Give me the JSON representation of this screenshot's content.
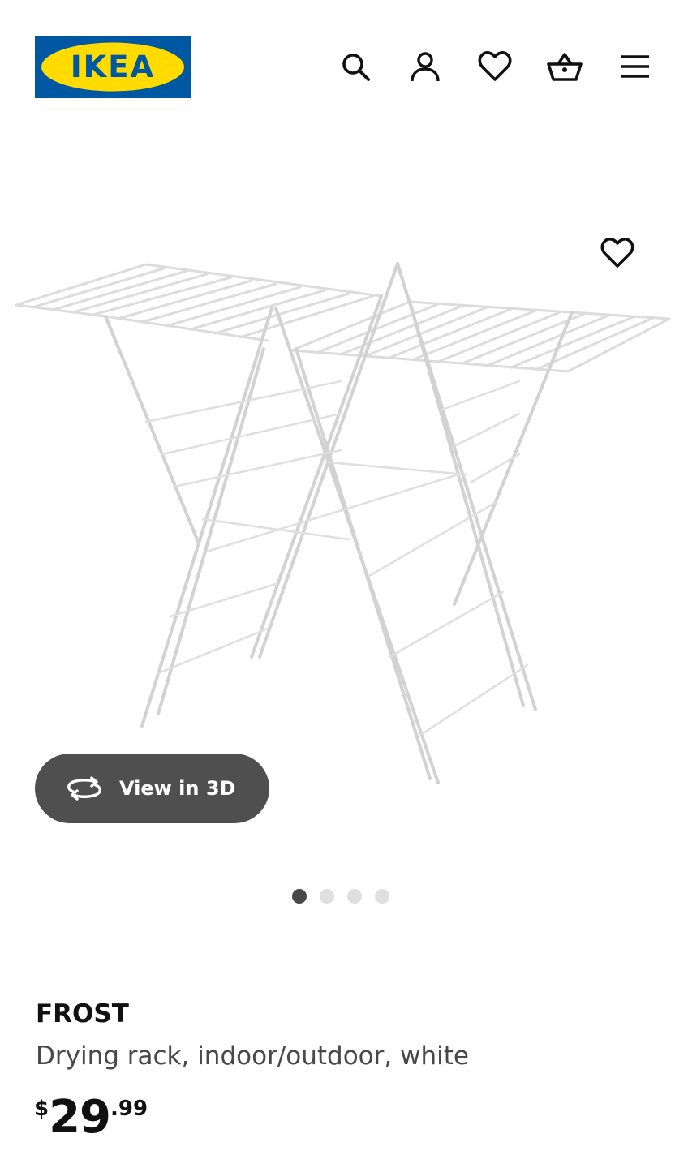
{
  "header": {
    "logo_text": "IKEA",
    "nav_icons": [
      "search-icon",
      "account-icon",
      "heart-icon",
      "basket-icon",
      "menu-icon"
    ]
  },
  "gallery": {
    "view3d_label": "View in 3D",
    "page_count": 4,
    "active_page": 1
  },
  "product": {
    "name": "FROST",
    "description": "Drying rack, indoor/outdoor, white",
    "price": {
      "currency": "$",
      "integer": "29",
      "decimal": ".99"
    }
  },
  "colors": {
    "ikea_blue": "#0058a3",
    "ikea_yellow": "#ffdb00",
    "button_dark": "#4f4f4f",
    "dot_active": "#484848",
    "dot_inactive": "#dfdfdf"
  }
}
